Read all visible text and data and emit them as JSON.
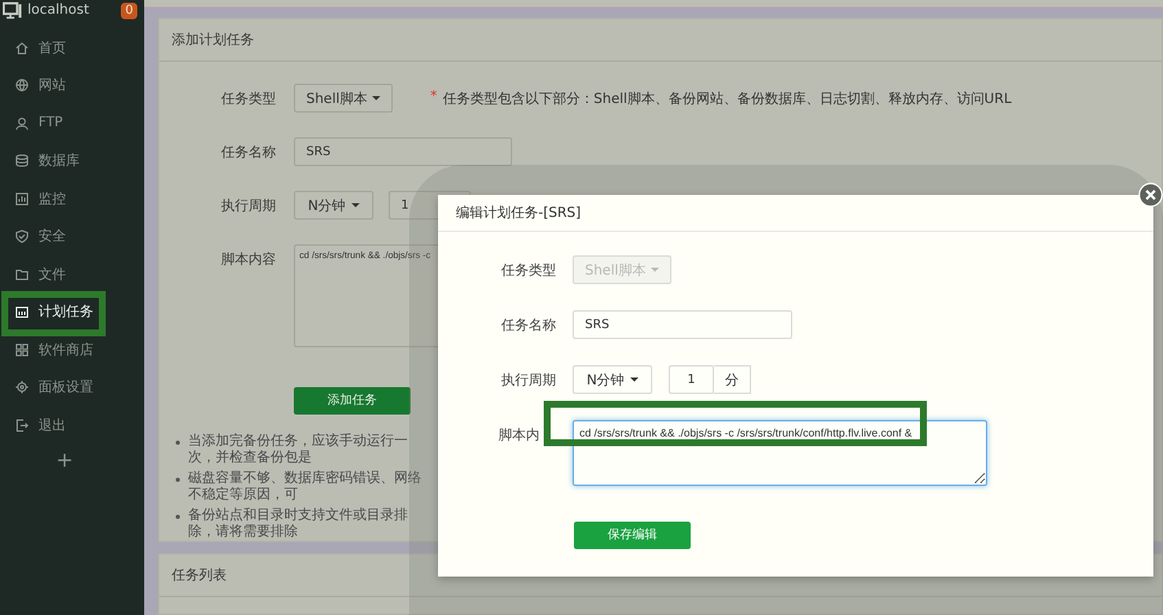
{
  "sidebar": {
    "host": "localhost",
    "badge": "0",
    "items": [
      {
        "label": "首页",
        "selected": false
      },
      {
        "label": "网站",
        "selected": false
      },
      {
        "label": "FTP",
        "selected": false
      },
      {
        "label": "数据库",
        "selected": false
      },
      {
        "label": "监控",
        "selected": false
      },
      {
        "label": "安全",
        "selected": false
      },
      {
        "label": "文件",
        "selected": false
      },
      {
        "label": "计划任务",
        "selected": true
      },
      {
        "label": "软件商店",
        "selected": false
      },
      {
        "label": "面板设置",
        "selected": false
      },
      {
        "label": "退出",
        "selected": false
      }
    ],
    "add_label": "+"
  },
  "add_panel": {
    "title": "添加计划任务",
    "fields": [
      {
        "kind": "dropdown",
        "label": "任务类型",
        "value": "Shell脚本",
        "note_mark": "*",
        "note": "任务类型包含以下部分：Shell脚本、备份网站、备份数据库、日志切割、释放内存、访问URL"
      },
      {
        "kind": "text",
        "label": "任务名称",
        "value": "SRS"
      },
      {
        "kind": "period",
        "label": "执行周期",
        "value": "N分钟",
        "count": "1"
      },
      {
        "kind": "textarea",
        "label": "脚本内容",
        "value": "cd /srs/srs/trunk && ./objs/srs -c"
      }
    ],
    "button": "添加任务",
    "notes": [
      "当添加完备份任务，应该手动运行一次，并检查备份包是",
      "磁盘容量不够、数据库密码错误、网络不稳定等原因，可",
      "备份站点和目录时支持文件或目录排除，请将需要排除"
    ]
  },
  "list_panel": {
    "title": "任务列表"
  },
  "modal": {
    "title": "编辑计划任务-[SRS]",
    "fields": [
      {
        "kind": "dropdown",
        "label": "任务类型",
        "value": "Shell脚本",
        "disabled": true,
        "focused": false
      },
      {
        "kind": "text",
        "label": "任务名称",
        "value": "SRS",
        "disabled": false,
        "focused": false
      },
      {
        "kind": "period",
        "label": "执行周期",
        "value": "N分钟",
        "count": "1",
        "unit": "分",
        "disabled": false,
        "focused": false
      },
      {
        "kind": "textarea",
        "label": "脚本内",
        "value": "cd /srs/srs/trunk && ./objs/srs -c /srs/srs/trunk/conf/http.flv.live.conf &",
        "disabled": false,
        "focused": true
      }
    ],
    "button": "保存编辑"
  }
}
